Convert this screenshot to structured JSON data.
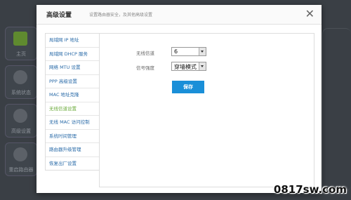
{
  "background": {
    "tiles": [
      "主页",
      "系统状态",
      "高级设置",
      "重启路由器"
    ]
  },
  "modal": {
    "title": "高级设置",
    "subtitle": "设置路由器安全，及其他高级设置",
    "close_glyph": "✕"
  },
  "menu": {
    "items": [
      {
        "label": "局域网 IP 地址"
      },
      {
        "label": "局域网 DHCP 服务"
      },
      {
        "label": "网络 MTU 设置"
      },
      {
        "label": "PPP 高级设置"
      },
      {
        "label": "MAC 地址克隆"
      },
      {
        "label": "无线信道设置"
      },
      {
        "label": "无线 MAC 访问控制"
      },
      {
        "label": "系统时间管理"
      },
      {
        "label": "路由器升级管理"
      },
      {
        "label": "恢复出厂设置"
      }
    ],
    "active_index": 5
  },
  "form": {
    "channel_label": "无线信道",
    "channel_value": "6",
    "strength_label": "信号强度",
    "strength_value": "穿墙模式",
    "save_label": "保存"
  },
  "watermark": "0817sw.com",
  "colors": {
    "accent": "#1a8fd8",
    "menu_link": "#2a6ba8",
    "menu_active": "#6aaa3a"
  }
}
